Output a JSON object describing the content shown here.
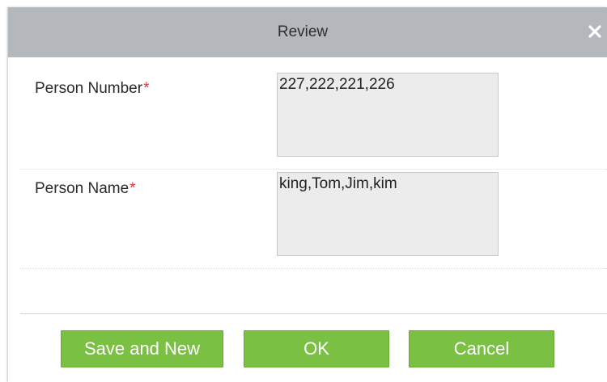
{
  "dialog": {
    "title": "Review",
    "close_icon": "close-icon"
  },
  "form": {
    "person_number": {
      "label": "Person Number",
      "required_mark": "*",
      "value": "227,222,221,226"
    },
    "person_name": {
      "label": "Person Name",
      "required_mark": "*",
      "value": "king,Tom,Jim,kim"
    }
  },
  "buttons": {
    "save_and_new": "Save and New",
    "ok": "OK",
    "cancel": "Cancel"
  },
  "colors": {
    "titlebar": "#b4b7bb",
    "button_green": "#7ac143",
    "required_red": "#e0383b",
    "field_background": "#ececec"
  }
}
